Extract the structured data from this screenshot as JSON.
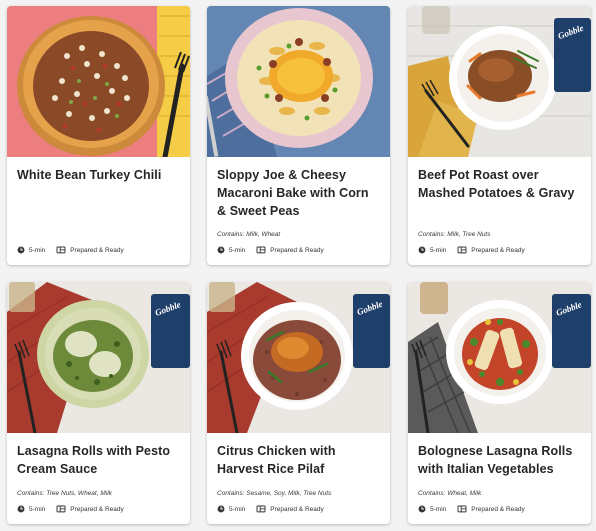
{
  "colors": {
    "card_bg": "#ffffff",
    "page_bg": "#f3f3f3",
    "title_text": "#262626",
    "meta_icon": "#333333",
    "brand_box": "#1f3f6b"
  },
  "meta_icons": {
    "time": "clock-icon",
    "prep": "meal-tray-icon"
  },
  "recipes": [
    {
      "title": "White Bean Turkey Chili",
      "contains": "",
      "time": "5-min",
      "prep": "Prepared & Ready",
      "image": "chili-bowl-photo"
    },
    {
      "title": "Sloppy Joe & Cheesy Macaroni Bake with Corn & Sweet Peas",
      "contains": "Contains: Milk, Wheat",
      "time": "5-min",
      "prep": "Prepared & Ready",
      "image": "macaroni-plate-photo"
    },
    {
      "title": "Beef Pot Roast over Mashed Potatoes & Gravy",
      "contains": "Contains: Milk, Tree Nuts",
      "time": "5-min",
      "prep": "Prepared & Ready",
      "image": "pot-roast-plate-photo",
      "brand_logo": "Gobble"
    },
    {
      "title": "Lasagna Rolls with Pesto Cream Sauce",
      "contains": "Contains: Tree Nuts, Wheat, Milk",
      "time": "5-min",
      "prep": "Prepared & Ready",
      "image": "lasagna-pesto-plate-photo",
      "brand_logo": "Gobble"
    },
    {
      "title": "Citrus Chicken with Harvest Rice Pilaf",
      "contains": "Contains: Sesame, Soy, Milk, Tree Nuts",
      "time": "5-min",
      "prep": "Prepared & Ready",
      "image": "citrus-chicken-plate-photo",
      "brand_logo": "Gobble"
    },
    {
      "title": "Bolognese Lasagna Rolls with Italian Vegetables",
      "contains": "Contains: Wheat, Milk",
      "time": "5-min",
      "prep": "Prepared & Ready",
      "image": "bolognese-plate-photo",
      "brand_logo": "Gobble"
    }
  ]
}
